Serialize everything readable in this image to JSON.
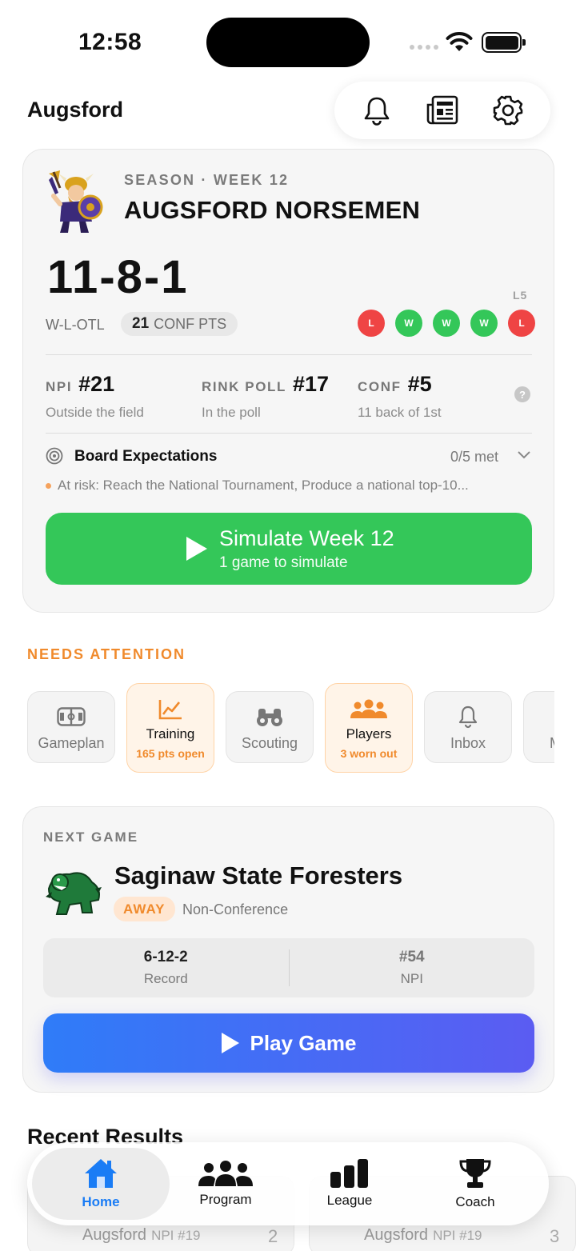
{
  "status_bar": {
    "time": "12:58"
  },
  "header": {
    "title": "Augsford"
  },
  "season_card": {
    "season_label": "SEASON · WEEK 12",
    "team_name": "AUGSFORD NORSEMEN",
    "record": "11-8-1",
    "record_format": "W-L-OTL",
    "conf_pts_value": "21",
    "conf_pts_label": "CONF PTS",
    "form_label": "L5",
    "form": [
      "L",
      "W",
      "W",
      "W",
      "L"
    ],
    "rankings": [
      {
        "label": "NPI",
        "value": "#21",
        "sub": "Outside the field"
      },
      {
        "label": "RINK POLL",
        "value": "#17",
        "sub": "In the poll"
      },
      {
        "label": "CONF",
        "value": "#5",
        "sub": "11 back of 1st"
      }
    ],
    "help_glyph": "?",
    "board": {
      "title": "Board Expectations",
      "met": "0/5 met",
      "risk": "At risk: Reach the National Tournament, Produce a national top-10..."
    },
    "simulate": {
      "title": "Simulate Week 12",
      "subtitle": "1 game to simulate"
    }
  },
  "needs_attention": {
    "label": "NEEDS ATTENTION",
    "tiles": [
      {
        "label": "Gameplan",
        "sub": "",
        "icon": "rink-icon",
        "highlight": false
      },
      {
        "label": "Training",
        "sub": "165 pts open",
        "icon": "trend-chart-icon",
        "highlight": true
      },
      {
        "label": "Scouting",
        "sub": "",
        "icon": "binoculars-icon",
        "highlight": false
      },
      {
        "label": "Players",
        "sub": "3 worn out",
        "icon": "group-icon",
        "highlight": true
      },
      {
        "label": "Inbox",
        "sub": "",
        "icon": "bell-icon",
        "highlight": false
      },
      {
        "label": "M",
        "sub": "",
        "icon": "partial-tile",
        "highlight": false
      }
    ]
  },
  "next_game": {
    "label": "NEXT GAME",
    "opponent": "Saginaw State Foresters",
    "location": "AWAY",
    "type": "Non-Conference",
    "record_value": "6-12-2",
    "record_label": "Record",
    "npi_value": "#54",
    "npi_label": "NPI",
    "play_label": "Play Game"
  },
  "recent_results": {
    "title": "Recent Results",
    "cards": [
      {
        "team": "Augsford",
        "npi": "NPI #19",
        "score": "2"
      },
      {
        "team": "Augsford",
        "npi": "NPI #19",
        "score": "3"
      }
    ]
  },
  "tabbar": {
    "active": "Home",
    "tabs": [
      {
        "label": "Home",
        "icon": "house-icon"
      },
      {
        "label": "Program",
        "icon": "people-icon"
      },
      {
        "label": "League",
        "icon": "bar-chart-icon"
      },
      {
        "label": "Coach",
        "icon": "trophy-icon"
      }
    ]
  },
  "colors": {
    "accent_green": "#34c759",
    "loss_red": "#ef4444",
    "attention_orange": "#f08a2c",
    "tab_active_blue": "#1a7cf5",
    "play_gradient_start": "#2f7cf8",
    "play_gradient_end": "#5b5cf2"
  }
}
